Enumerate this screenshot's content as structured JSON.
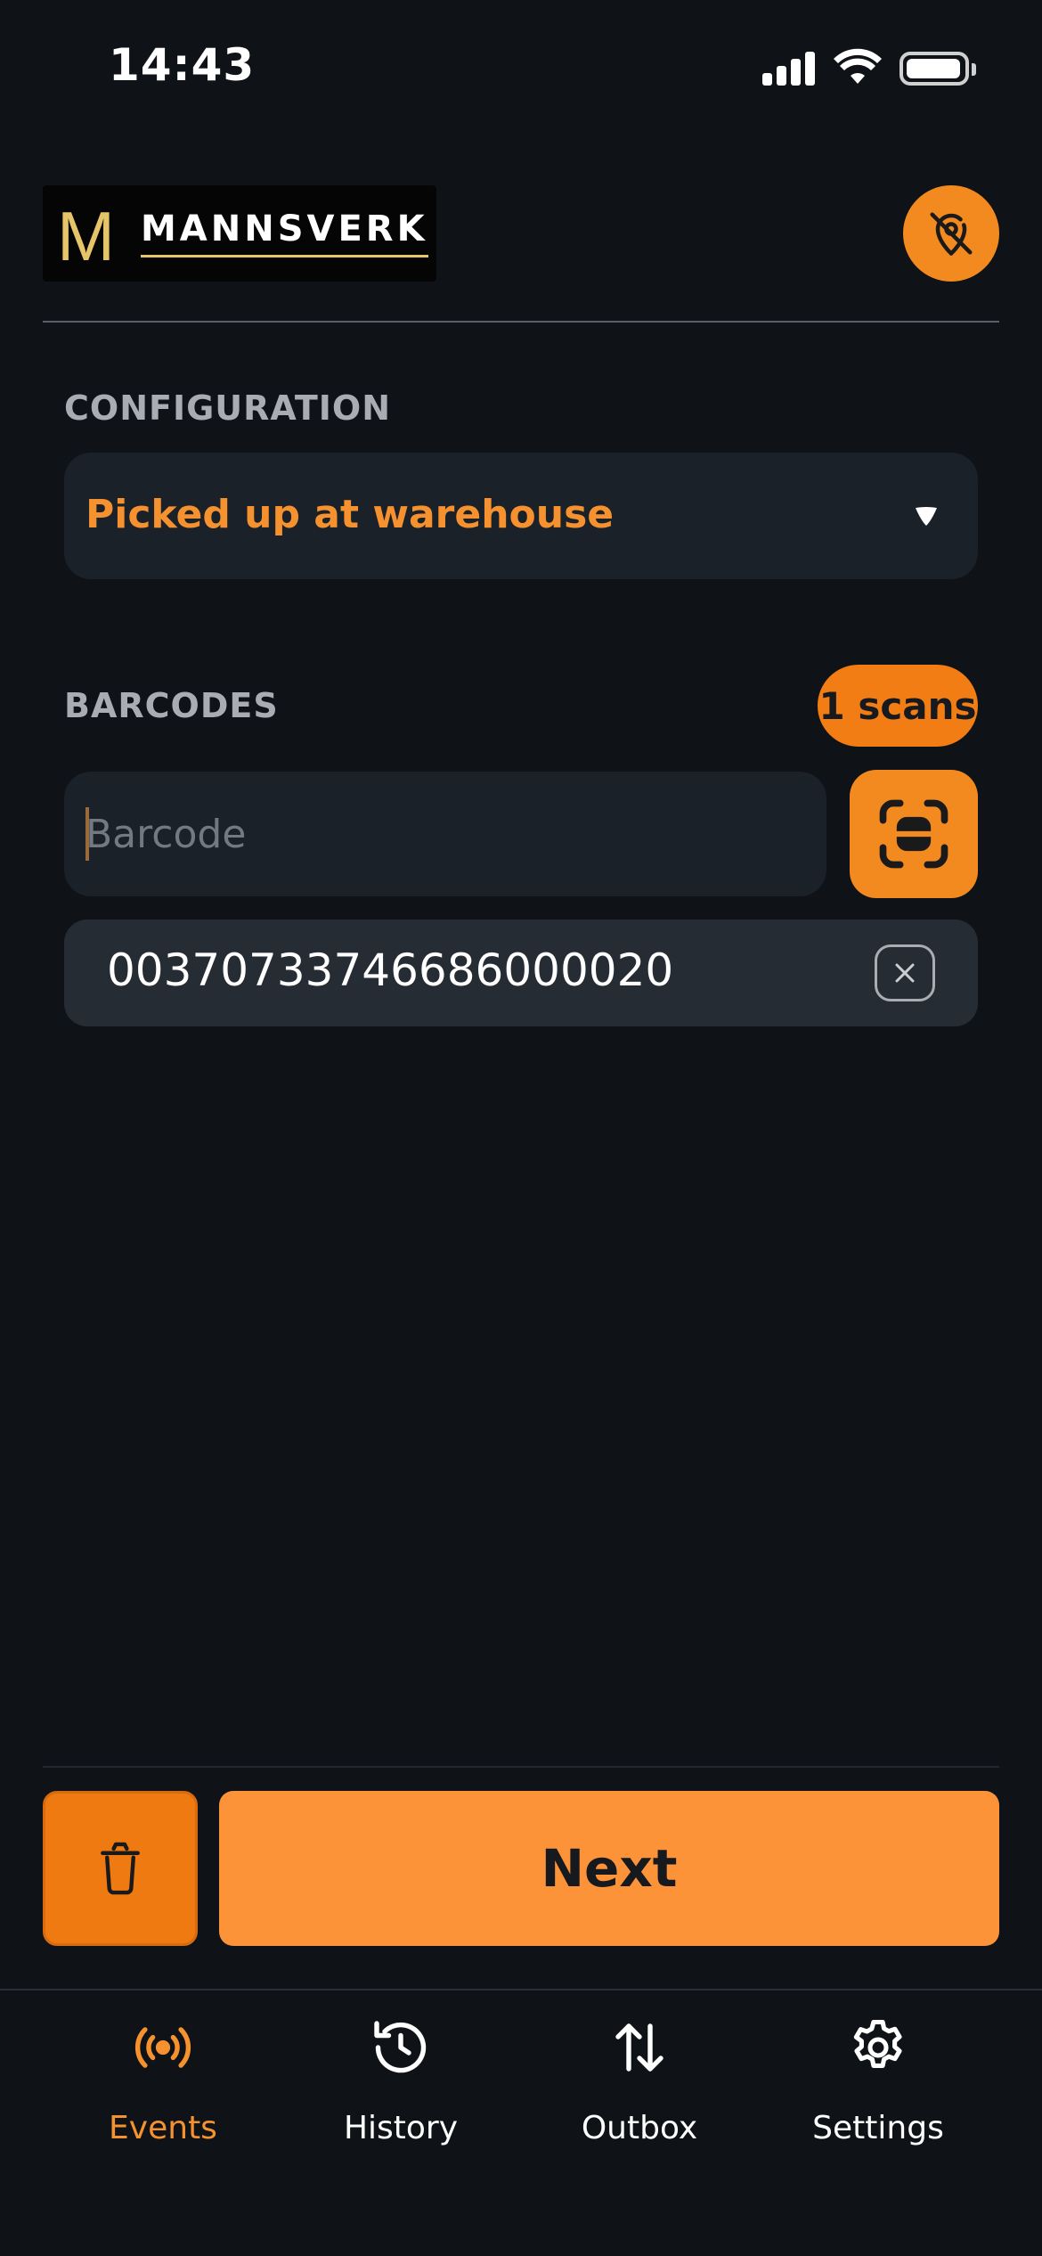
{
  "status_bar": {
    "time": "14:43"
  },
  "header": {
    "logo_mark": "M",
    "logo_text": "MANNSVERK",
    "location_button_icon": "location-off-icon"
  },
  "configuration": {
    "label": "CONFIGURATION",
    "selected_value": "Picked up at warehouse"
  },
  "barcodes": {
    "label": "BARCODES",
    "scan_count": "1 scans",
    "input_placeholder": "Barcode",
    "input_value": "",
    "items": [
      {
        "code": "00370733746686000020"
      }
    ]
  },
  "actions": {
    "next_label": "Next",
    "delete_icon": "trash-icon"
  },
  "tabs": [
    {
      "label": "Events",
      "icon": "broadcast-icon",
      "active": true
    },
    {
      "label": "History",
      "icon": "history-icon",
      "active": false
    },
    {
      "label": "Outbox",
      "icon": "sync-arrows-icon",
      "active": false
    },
    {
      "label": "Settings",
      "icon": "gear-icon",
      "active": false
    }
  ],
  "colors": {
    "accent": "#f38a1f",
    "background": "#0f1317",
    "surface": "#1b2128",
    "logo_gold": "#e5c46a"
  }
}
